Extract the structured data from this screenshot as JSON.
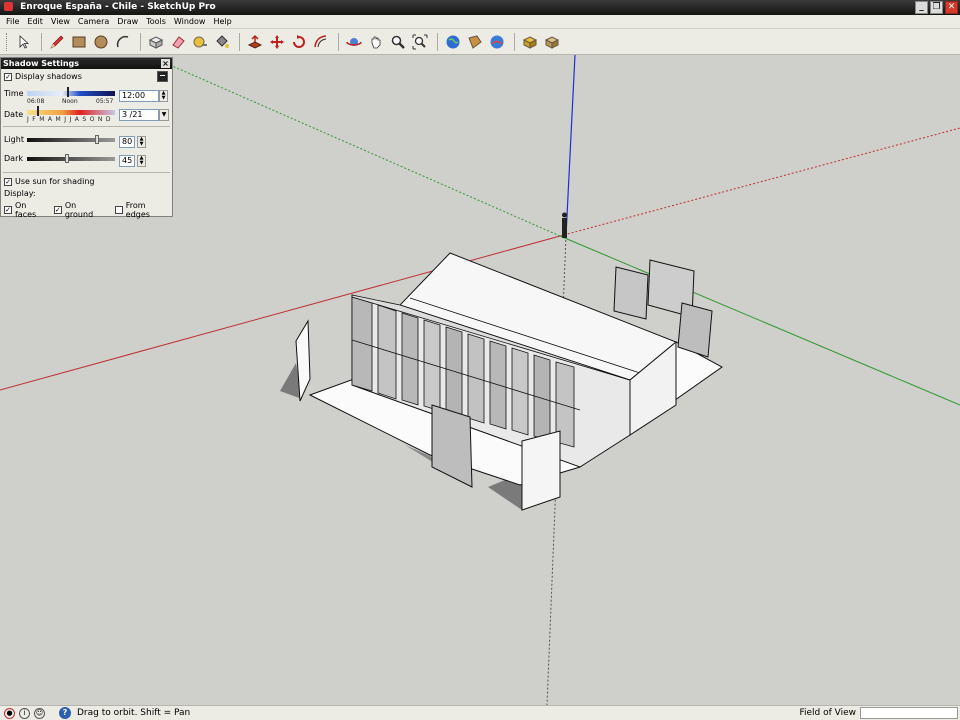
{
  "window": {
    "title": "Enroque España - Chile - SketchUp Pro",
    "minimize": "_",
    "restore": "❐",
    "close": "✕"
  },
  "menu": [
    "File",
    "Edit",
    "View",
    "Camera",
    "Draw",
    "Tools",
    "Window",
    "Help"
  ],
  "toolbar": {
    "tools": [
      {
        "name": "select-tool-icon"
      },
      {
        "name": "pencil-tool-icon"
      },
      {
        "name": "rectangle-tool-icon"
      },
      {
        "name": "circle-tool-icon"
      },
      {
        "name": "arc-tool-icon"
      },
      {
        "name": "make-component-icon"
      },
      {
        "name": "eraser-tool-icon"
      },
      {
        "name": "tape-measure-icon"
      },
      {
        "name": "paint-bucket-icon"
      },
      {
        "name": "push-pull-icon"
      },
      {
        "name": "move-tool-icon"
      },
      {
        "name": "rotate-tool-icon"
      },
      {
        "name": "offset-tool-icon"
      },
      {
        "name": "orbit-tool-icon"
      },
      {
        "name": "pan-tool-icon"
      },
      {
        "name": "zoom-tool-icon"
      },
      {
        "name": "zoom-extents-icon"
      },
      {
        "name": "get-models-icon"
      },
      {
        "name": "share-model-icon"
      },
      {
        "name": "google-earth-icon"
      },
      {
        "name": "get-component-icon"
      },
      {
        "name": "share-component-icon"
      }
    ]
  },
  "shadow_settings": {
    "title": "Shadow Settings",
    "close": "×",
    "display_shadows_label": "Display shadows",
    "display_shadows_checked": true,
    "time_label": "Time",
    "time_start": "06:08",
    "time_mid": "Noon",
    "time_end": "05:57",
    "time_value": "12:00",
    "date_label": "Date",
    "months": "J F M A M J J A S O N D",
    "date_value": "3 /21",
    "light_label": "Light",
    "light_value": "80",
    "light_level": 0.8,
    "dark_label": "Dark",
    "dark_value": "45",
    "dark_level": 0.45,
    "use_sun_label": "Use sun for shading",
    "use_sun_checked": true,
    "display_label": "Display:",
    "on_faces_label": "On faces",
    "on_faces_checked": true,
    "on_ground_label": "On ground",
    "on_ground_checked": true,
    "from_edges_label": "From edges",
    "from_edges_checked": false
  },
  "status": {
    "hint": "Drag to orbit.  Shift = Pan",
    "fov_label": "Field of View",
    "fov_value": ""
  }
}
